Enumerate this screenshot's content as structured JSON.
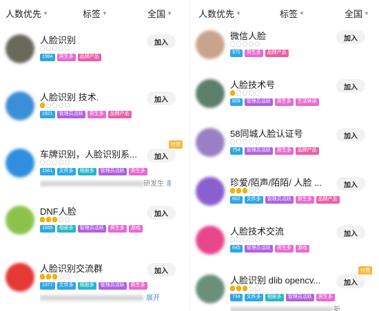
{
  "left": {
    "filters": {
      "sort": "人数优先",
      "tag": "标签",
      "region": "全国"
    },
    "rows": [
      {
        "title": "人脸识别",
        "members": "1984",
        "levels": 0,
        "tags": [
          "男生多",
          "品牌产品"
        ],
        "join": "加入"
      },
      {
        "title": "人脸识别 技术.",
        "members": "1921",
        "levels": 1,
        "tags": [
          "管理员活跃",
          "男生多",
          "品牌产品"
        ],
        "join": "加入"
      },
      {
        "title": "车牌识别，人脸识别系...",
        "members": "1561",
        "levels": 0,
        "tags": [
          "文件多",
          "相册多",
          "管理员活跃",
          "男生多"
        ],
        "desc": "研发生",
        "more": "展开",
        "paid": "付费",
        "join": "加入"
      },
      {
        "title": "DNF人脸",
        "members": "1655",
        "levels": 3,
        "tags": [
          "相册多",
          "管理员活跃",
          "男生多",
          "游戏"
        ],
        "join": "加入"
      },
      {
        "title": "人脸识别交流群",
        "members": "1377",
        "levels": 3,
        "tags": [
          "文件多",
          "相册多",
          "管理员活跃",
          "男生多"
        ],
        "more": "展开",
        "join": "加入"
      }
    ]
  },
  "right": {
    "filters": {
      "sort": "人数优先",
      "tag": "标签",
      "region": "全国"
    },
    "rows": [
      {
        "title": "微信人脸",
        "members": "970",
        "levels": 0,
        "tags": [
          "男生多",
          "品牌产品"
        ],
        "join": "加入"
      },
      {
        "title": "人脸技术号",
        "members": "809",
        "levels": 1,
        "tags": [
          "管理员活跃",
          "男生多",
          "生活休闲"
        ],
        "join": "加入"
      },
      {
        "title": "58同城人脸认证号",
        "members": "754",
        "levels": 0,
        "tags": [
          "管理员活跃",
          "男生多",
          "品牌产品"
        ],
        "join": "加入"
      },
      {
        "title": "珍爱/陌声/陌陌/ 人脸 ...",
        "members": "602",
        "levels": 3,
        "tags": [
          "文件多",
          "管理员活跃",
          "男生多",
          "品牌产品"
        ],
        "join": "加入"
      },
      {
        "title": "人脸技术交流",
        "members": "645",
        "levels": 0,
        "tags": [
          "管理员活跃",
          "男生多",
          "游戏"
        ],
        "join": "加入"
      },
      {
        "title": "人脸识别 dlib opencv...",
        "members": "734",
        "levels": 3,
        "tags": [
          "文件多",
          "相册多",
          "管理员活跃",
          "男生多"
        ],
        "paid": "付费",
        "desc": "新",
        "join": "加入"
      }
    ]
  },
  "avatar_colors": {
    "left": [
      "#6a6a5a",
      "#3a8fd6",
      "#2f8ee0",
      "#8bc34a",
      "#e53935"
    ],
    "right": [
      "#c9a48c",
      "#5b7f6a",
      "#9a7fc4",
      "#8a5fd0",
      "#e8478d",
      "#6b8f7a"
    ]
  }
}
